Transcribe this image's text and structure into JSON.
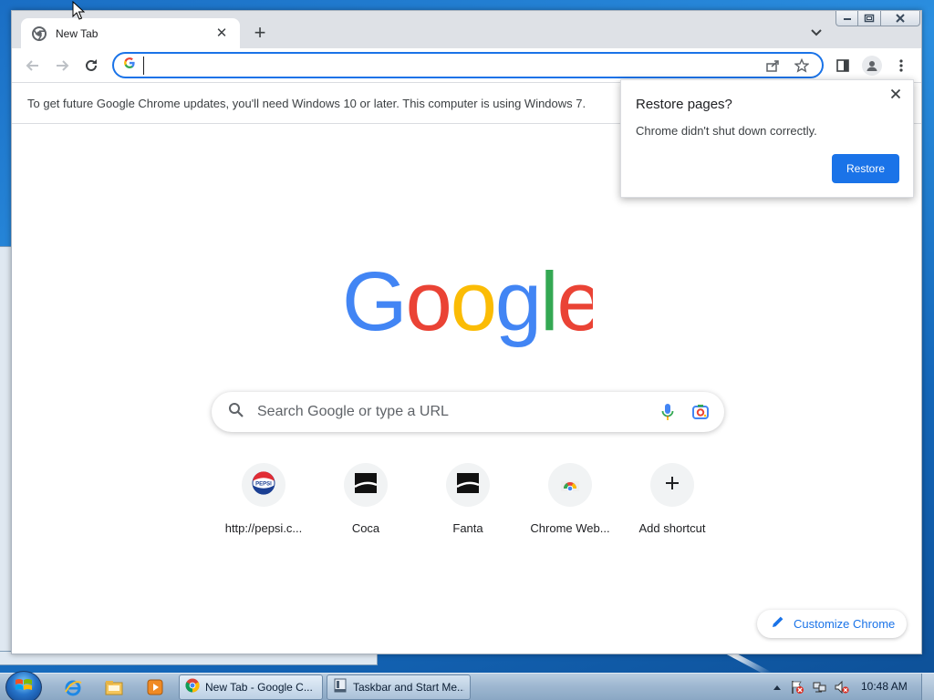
{
  "window": {
    "tab_title": "New Tab",
    "new_tab_symbol": "+",
    "tab_close_symbol": "✕"
  },
  "omnibox": {
    "value": "",
    "placeholder": ""
  },
  "infobar": {
    "message": "To get future Google Chrome updates, you'll need Windows 10 or later. This computer is using Windows 7."
  },
  "restore_popup": {
    "title": "Restore pages?",
    "body": "Chrome didn't shut down correctly.",
    "button_label": "Restore"
  },
  "ntp": {
    "logo_text": "Google",
    "search_placeholder": "Search Google or type a URL",
    "shortcuts": [
      {
        "label": "http://pepsi.c...",
        "icon": "pepsi-icon"
      },
      {
        "label": "Coca",
        "icon": "black-square-icon"
      },
      {
        "label": "Fanta",
        "icon": "black-square-icon"
      },
      {
        "label": "Chrome Web...",
        "icon": "chrome-webstore-icon"
      },
      {
        "label": "Add shortcut",
        "icon": "plus-icon"
      }
    ],
    "customize_label": "Customize Chrome"
  },
  "taskbar": {
    "tasks": [
      {
        "label": "New Tab - Google C...",
        "icon": "chrome-icon"
      },
      {
        "label": "Taskbar and Start Me...",
        "icon": "taskbar-settings-icon"
      }
    ],
    "clock": "10:48 AM"
  },
  "colors": {
    "accent": "#1a73e8",
    "google_blue": "#4285f4",
    "google_red": "#ea4335",
    "google_yellow": "#fbbc05",
    "google_green": "#34a853"
  }
}
